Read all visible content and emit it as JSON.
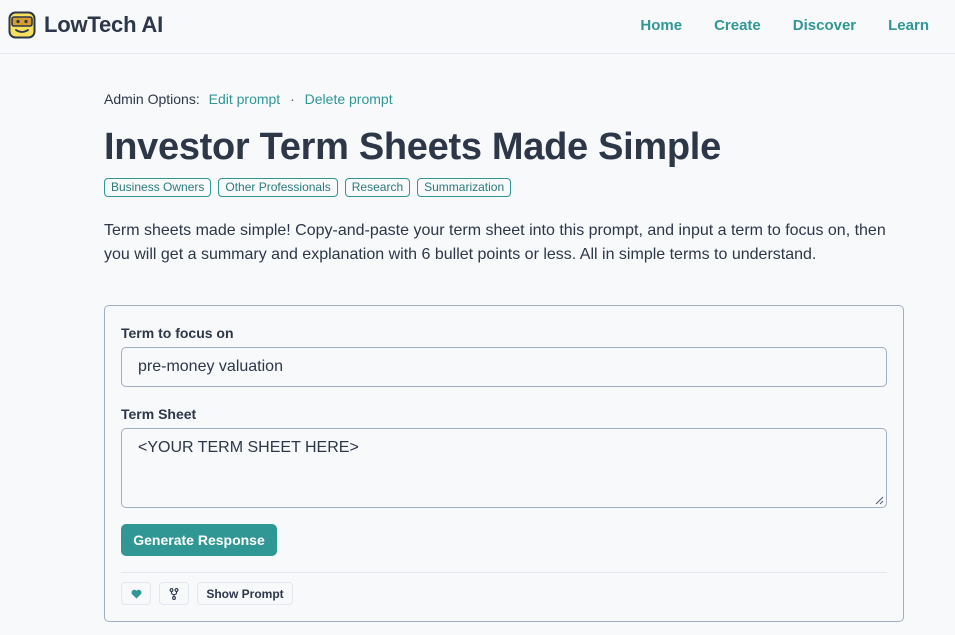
{
  "brand": {
    "name": "LowTech AI",
    "logo_icon": "robot-face-icon"
  },
  "nav": {
    "items": [
      {
        "label": "Home"
      },
      {
        "label": "Create"
      },
      {
        "label": "Discover"
      },
      {
        "label": "Learn"
      }
    ]
  },
  "admin": {
    "label": "Admin Options:",
    "edit_label": "Edit prompt",
    "separator": "·",
    "delete_label": "Delete prompt"
  },
  "page": {
    "title": "Investor Term Sheets Made Simple",
    "tags": [
      "Business Owners",
      "Other Professionals",
      "Research",
      "Summarization"
    ],
    "description": "Term sheets made simple! Copy-and-paste your term sheet into this prompt, and input a term to focus on, then you will get a summary and explanation with 6 bullet points or less. All in simple terms to understand."
  },
  "form": {
    "term_label": "Term to focus on",
    "term_value": "pre-money valuation",
    "sheet_label": "Term Sheet",
    "sheet_value": "<YOUR TERM SHEET HERE>",
    "generate_label": "Generate Response",
    "like_icon": "heart-icon",
    "fork_icon": "fork-icon",
    "show_prompt_label": "Show Prompt"
  },
  "colors": {
    "accent": "#319795",
    "text": "#2d3748",
    "border": "#a0aec0",
    "background": "#f7f9fb"
  }
}
